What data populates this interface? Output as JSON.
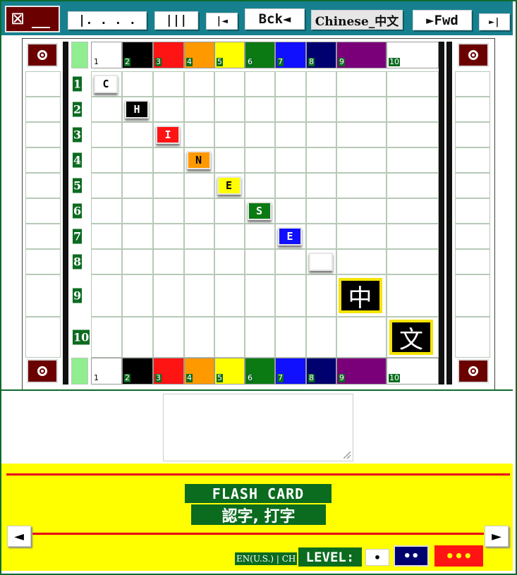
{
  "toolbar": {
    "close_glyph": "⊠",
    "btn_dots": "|. . . .",
    "btn_bars": "|||",
    "btn_first": "|◄",
    "btn_back": "Bck◄",
    "btn_lang": "Chinese_中文",
    "btn_fwd": "►Fwd",
    "btn_last": "►|"
  },
  "board": {
    "columns": [
      {
        "label": "1",
        "color": "#ffffff"
      },
      {
        "label": "2",
        "color": "#000000"
      },
      {
        "label": "3",
        "color": "#ff1414"
      },
      {
        "label": "4",
        "color": "#ff9900"
      },
      {
        "label": "5",
        "color": "#ffff00"
      },
      {
        "label": "6",
        "color": "#0b7a13"
      },
      {
        "label": "7",
        "color": "#1010ff"
      },
      {
        "label": "8",
        "color": "#00006e"
      },
      {
        "label": "9",
        "color": "#7a007a"
      },
      {
        "label": "10",
        "color": "#ffffff"
      }
    ],
    "rows": [
      "1",
      "2",
      "3",
      "4",
      "5",
      "6",
      "7",
      "8",
      "9",
      "10"
    ],
    "tiles": [
      {
        "row": 1,
        "col": 1,
        "letter": "C",
        "bg": "#ffffff",
        "fg": "#000000"
      },
      {
        "row": 2,
        "col": 2,
        "letter": "H",
        "bg": "#000000",
        "fg": "#ffffff"
      },
      {
        "row": 3,
        "col": 3,
        "letter": "I",
        "bg": "#ff1414",
        "fg": "#ffffff"
      },
      {
        "row": 4,
        "col": 4,
        "letter": "N",
        "bg": "#ff9900",
        "fg": "#000000"
      },
      {
        "row": 5,
        "col": 5,
        "letter": "E",
        "bg": "#ffff00",
        "fg": "#000000"
      },
      {
        "row": 6,
        "col": 6,
        "letter": "S",
        "bg": "#0b7a13",
        "fg": "#ffffff"
      },
      {
        "row": 7,
        "col": 7,
        "letter": "E",
        "bg": "#1010ff",
        "fg": "#ffffff"
      },
      {
        "row": 8,
        "col": 8,
        "letter": "",
        "bg": "#ffffff",
        "fg": "#000000"
      }
    ],
    "big_tiles": [
      {
        "row": 9,
        "col": 9,
        "char": "中"
      },
      {
        "row": 10,
        "col": 10,
        "char": "文"
      }
    ]
  },
  "panel": {
    "title": "FLASH CARD",
    "subtitle": "認字, 打字",
    "prev": "◄",
    "next": "►",
    "lang_toggle": "EN(U.S.) | CH",
    "level_label": "LEVEL:",
    "level1": "•",
    "level2": "••",
    "level3": "•••"
  },
  "colors": {
    "toolbar_bg": "#17808f",
    "dark_red": "#6b0000",
    "green": "#0b6b1f",
    "panel_yellow": "#ffff00",
    "red_line": "#e8001c"
  }
}
